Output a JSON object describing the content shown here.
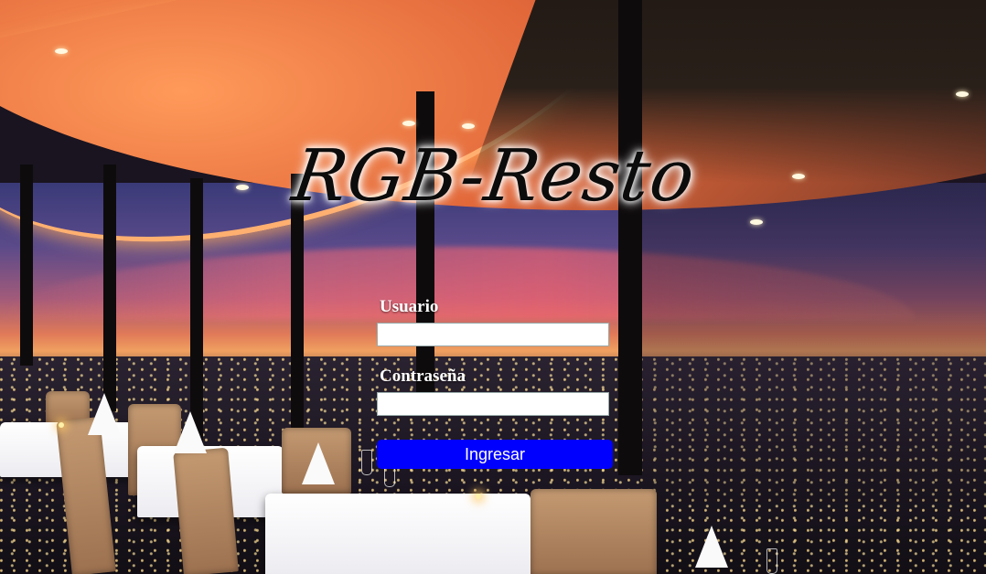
{
  "app": {
    "brand_title": "RGB-Resto"
  },
  "login_form": {
    "username_label": "Usuario",
    "username_value": "",
    "password_label": "Contraseña",
    "password_value": "",
    "submit_label": "Ingresar"
  },
  "colors": {
    "submit_button": "#0000ff",
    "field_label": "#ffffff",
    "title_text": "#0c0c0c"
  }
}
